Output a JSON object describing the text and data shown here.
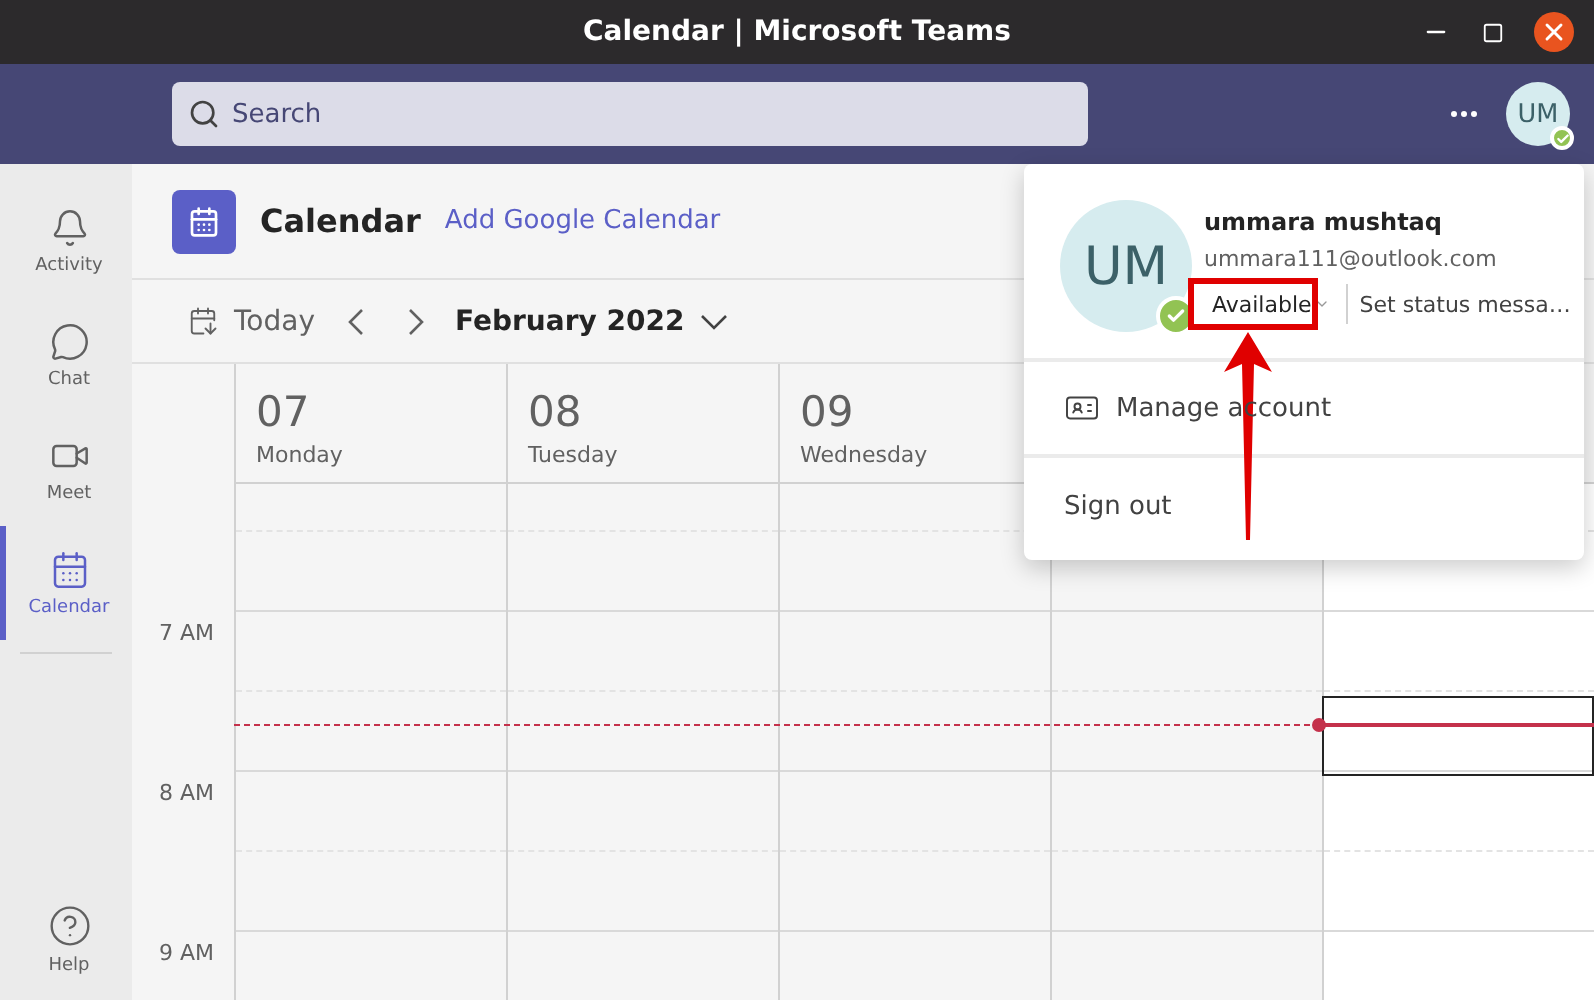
{
  "window": {
    "title": "Calendar | Microsoft Teams"
  },
  "search": {
    "placeholder": "Search"
  },
  "account": {
    "initials": "UM",
    "online": true
  },
  "rail": [
    {
      "label": "Activity",
      "kind": "bell",
      "selected": false
    },
    {
      "label": "Chat",
      "kind": "chat",
      "selected": false
    },
    {
      "label": "Meet",
      "kind": "video",
      "selected": false
    },
    {
      "label": "Calendar",
      "kind": "calendar",
      "selected": true
    }
  ],
  "help": {
    "label": "Help"
  },
  "header": {
    "title": "Calendar",
    "link": "Add Google Calendar"
  },
  "toolbar": {
    "today": "Today",
    "month": "February 2022"
  },
  "days": [
    {
      "date": "07",
      "weekday": "Monday"
    },
    {
      "date": "08",
      "weekday": "Tuesday"
    },
    {
      "date": "09",
      "weekday": "Wednesday"
    }
  ],
  "times": [
    "7 AM",
    "8 AM",
    "9 AM"
  ],
  "profile": {
    "initials": "UM",
    "online": true,
    "name": "ummara mushtaq",
    "email": "ummara111@outlook.com",
    "status": "Available",
    "status_message": "Set status messa…",
    "menu": [
      {
        "label": "Manage account",
        "kind": "card"
      },
      {
        "label": "Sign out",
        "kind": "plain"
      }
    ]
  }
}
